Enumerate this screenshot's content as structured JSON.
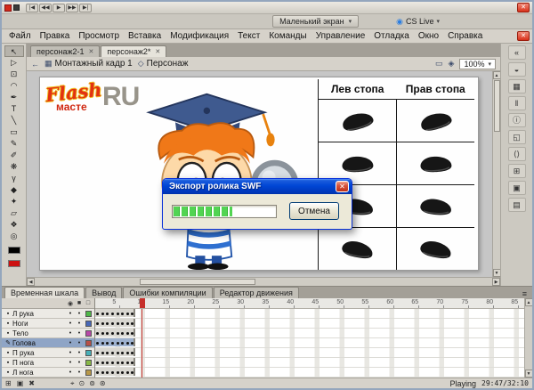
{
  "icons": {
    "close": "✕",
    "chevron_down": "▾",
    "cs_live_sphere": "◉",
    "back_arrow": "←",
    "scene": "▦",
    "symbol": "◇",
    "edit_scene": "▭",
    "edit_symbol": "◈",
    "eye": "◉",
    "lock": "■",
    "outline": "□",
    "pencil": "✎",
    "layer_page": "▪",
    "dot": "•",
    "new_layer": "⊞",
    "new_folder": "▣",
    "delete_layer": "✖",
    "onion_skin": "⊙",
    "onion_outline": "⊚",
    "edit_multiple": "⊛",
    "center_frame": "⌖",
    "panel_menu": "≡",
    "left": "◀",
    "right": "▶",
    "up": "▲",
    "down": "▼"
  },
  "titlebar": {
    "playback": [
      {
        "name": "go-first-button",
        "glyph": "|◀"
      },
      {
        "name": "rewind-button",
        "glyph": "◀◀"
      },
      {
        "name": "play-button",
        "glyph": "▶"
      },
      {
        "name": "forward-button",
        "glyph": "▶▶"
      },
      {
        "name": "go-last-button",
        "glyph": "▶|"
      }
    ]
  },
  "appbar": {
    "workspace": "Маленький экран",
    "cs_live": "CS Live"
  },
  "menu": {
    "items": [
      "Файл",
      "Правка",
      "Просмотр",
      "Вставка",
      "Модификация",
      "Текст",
      "Команды",
      "Управление",
      "Отладка",
      "Окно",
      "Справка"
    ]
  },
  "doc_tabs": [
    {
      "label": "персонаж2-1",
      "active": false
    },
    {
      "label": "персонаж2*",
      "active": true
    }
  ],
  "editbar": {
    "scene": "Монтажный кадр 1",
    "symbol": "Персонаж",
    "zoom": "100%"
  },
  "tools": [
    {
      "name": "selection-tool",
      "glyph": "↖"
    },
    {
      "name": "subselection-tool",
      "glyph": "▷"
    },
    {
      "name": "free-transform-tool",
      "glyph": "⊡"
    },
    {
      "name": "lasso-tool",
      "glyph": "◠"
    },
    {
      "name": "pen-tool",
      "glyph": "✒"
    },
    {
      "name": "text-tool",
      "glyph": "T"
    },
    {
      "name": "line-tool",
      "glyph": "╲"
    },
    {
      "name": "rectangle-tool",
      "glyph": "▭"
    },
    {
      "name": "pencil-tool",
      "glyph": "✎"
    },
    {
      "name": "brush-tool",
      "glyph": "✐"
    },
    {
      "name": "deco-tool",
      "glyph": "❋"
    },
    {
      "name": "bone-tool",
      "glyph": "γ"
    },
    {
      "name": "paint-bucket-tool",
      "glyph": "◆"
    },
    {
      "name": "eyedropper-tool",
      "glyph": "✦"
    },
    {
      "name": "eraser-tool",
      "glyph": "▱"
    },
    {
      "name": "hand-tool",
      "glyph": "❖"
    },
    {
      "name": "zoom-tool",
      "glyph": "◎"
    }
  ],
  "colors": {
    "stroke": "#000000",
    "fill": "#cc1111"
  },
  "right_panels": [
    {
      "name": "collapse-panels-icon",
      "glyph": "«"
    },
    {
      "name": "color-panel-icon",
      "glyph": "◒"
    },
    {
      "name": "swatches-panel-icon",
      "glyph": "▦"
    },
    {
      "name": "align-panel-icon",
      "glyph": "‖"
    },
    {
      "name": "info-panel-icon",
      "glyph": "ⓘ"
    },
    {
      "name": "transform-panel-icon",
      "glyph": "◱"
    },
    {
      "name": "code-snippets-panel-icon",
      "glyph": "⟨⟩"
    },
    {
      "name": "components-panel-icon",
      "glyph": "⊞"
    },
    {
      "name": "motion-presets-panel-icon",
      "glyph": "▣"
    },
    {
      "name": "library-panel-icon",
      "glyph": "▤"
    }
  ],
  "stage": {
    "logo": {
      "flash": "Flash",
      "maste": "масте",
      "ru": "RU"
    },
    "table": {
      "left_header": "Лев стопа",
      "right_header": "Прав стопа",
      "row_count": 4
    }
  },
  "dialog": {
    "title": "Экспорт ролика SWF",
    "cancel_label": "Отмена",
    "progress_percent": 58
  },
  "timeline": {
    "tabs": [
      {
        "label": "Временная шкала",
        "active": true
      },
      {
        "label": "Вывод",
        "active": false
      },
      {
        "label": "Ошибки компиляции",
        "active": false
      },
      {
        "label": "Редактор движения",
        "active": false
      }
    ],
    "layers": [
      {
        "name": "Л рука",
        "color": "#4fb848",
        "selected": false
      },
      {
        "name": "Ноги",
        "color": "#4868b8",
        "selected": false
      },
      {
        "name": "Тело",
        "color": "#b848a8",
        "selected": false
      },
      {
        "name": "Голова",
        "color": "#b85048",
        "selected": true
      },
      {
        "name": "П рука",
        "color": "#48b0b8",
        "selected": false
      },
      {
        "name": "П нога",
        "color": "#88b848",
        "selected": false
      },
      {
        "name": "Л нога",
        "color": "#b89848",
        "selected": false
      }
    ],
    "ruler_labels": [
      5,
      10,
      15,
      20,
      25,
      30,
      35,
      40,
      45,
      50,
      55,
      60,
      65,
      70,
      75,
      80,
      85
    ],
    "playhead_frame": 10,
    "keyframes_per_layer": 8,
    "status": {
      "playing": "Playing",
      "timecode": "29:47/32:10"
    }
  }
}
